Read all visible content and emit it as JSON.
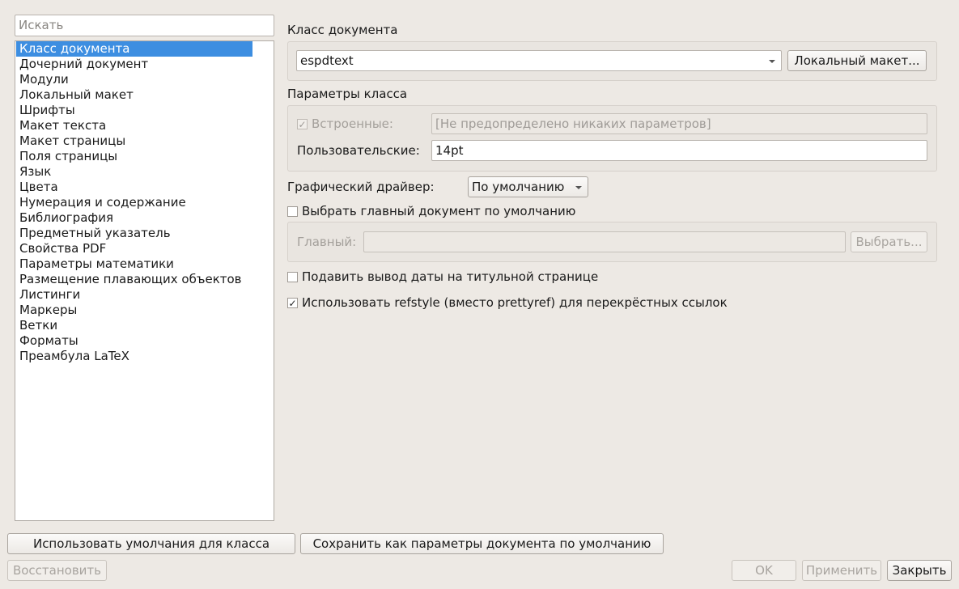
{
  "search": {
    "placeholder": "Искать"
  },
  "nav": {
    "items": [
      {
        "label": "Класс документа",
        "selected": true
      },
      {
        "label": "Дочерний документ"
      },
      {
        "label": "Модули"
      },
      {
        "label": "Локальный макет"
      },
      {
        "label": "Шрифты"
      },
      {
        "label": "Макет текста"
      },
      {
        "label": "Макет страницы"
      },
      {
        "label": "Поля страницы"
      },
      {
        "label": "Язык"
      },
      {
        "label": "Цвета"
      },
      {
        "label": "Нумерация и содержание"
      },
      {
        "label": "Библиография"
      },
      {
        "label": "Предметный указатель"
      },
      {
        "label": "Свойства PDF"
      },
      {
        "label": "Параметры математики"
      },
      {
        "label": "Размещение плавающих объектов"
      },
      {
        "label": "Листинги"
      },
      {
        "label": "Маркеры"
      },
      {
        "label": "Ветки"
      },
      {
        "label": "Форматы"
      },
      {
        "label": "Преамбула LaTeX"
      }
    ]
  },
  "doc_class": {
    "heading": "Класс документа",
    "selected": "espdtext",
    "local_layout_button": "Локальный макет..."
  },
  "class_params": {
    "heading": "Параметры класса",
    "builtin_label": "Встроенные:",
    "builtin_checked": true,
    "builtin_value": "[Не предопределено никаких параметров]",
    "custom_label": "Пользовательские:",
    "custom_value": "14pt"
  },
  "graphics": {
    "label": "Графический драйвер:",
    "selected": "По умолчанию"
  },
  "master": {
    "checkbox_label": "Выбрать главный документ по умолчанию",
    "checked": false,
    "main_label": "Главный:",
    "main_value": "",
    "choose_button": "Выбрать..."
  },
  "options": {
    "suppress_date_label": "Подавить вывод даты на титульной странице",
    "suppress_date_checked": false,
    "refstyle_label": "Использовать refstyle (вместо prettyref) для перекрёстных ссылок",
    "refstyle_checked": true
  },
  "footer": {
    "use_class_defaults": "Использовать умолчания для класса",
    "save_as_defaults": "Сохранить как параметры документа по умолчанию",
    "restore": "Восстановить",
    "ok": "OK",
    "apply": "Применить",
    "close": "Закрыть"
  },
  "colors": {
    "background": "#ede9e4",
    "selection": "#3d8ee1"
  }
}
